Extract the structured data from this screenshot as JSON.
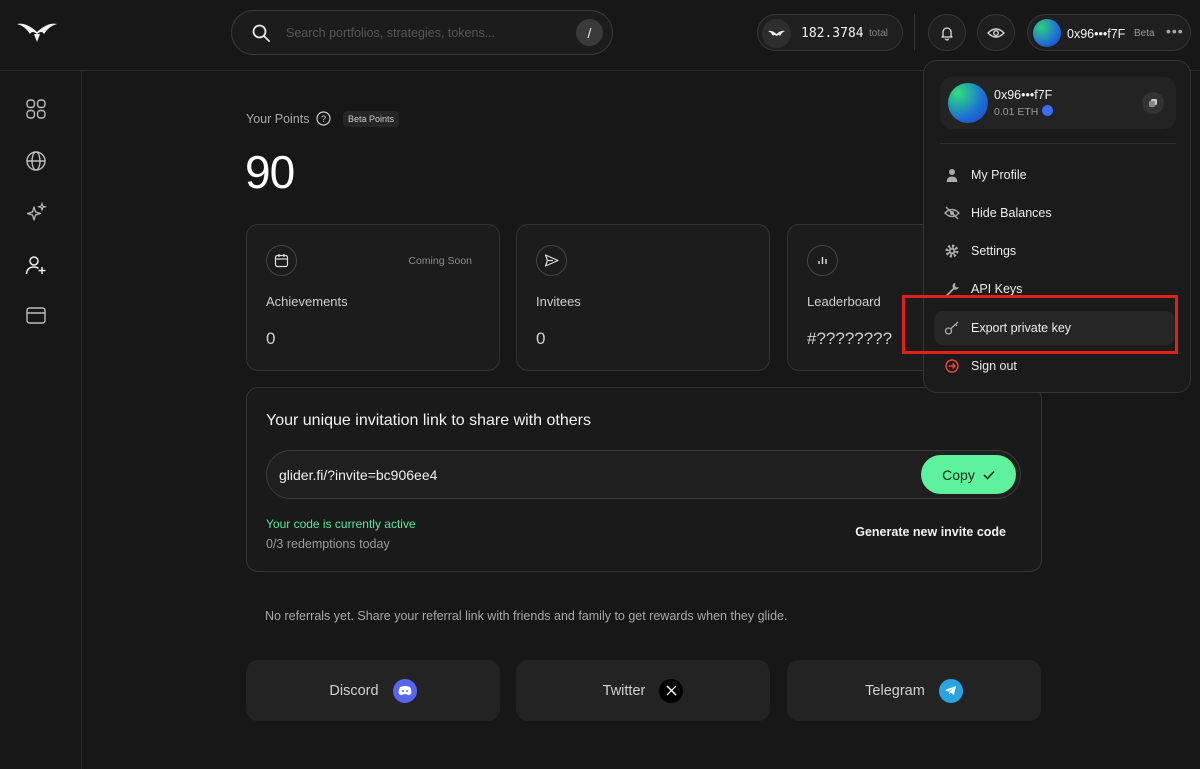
{
  "search": {
    "placeholder": "Search portfolios, strategies, tokens...",
    "shortcut": "/"
  },
  "balance": {
    "value": "182.3784",
    "suffix": "total"
  },
  "account": {
    "address": "0x96•••f7F",
    "badge": "Beta",
    "more": "•••"
  },
  "sidebar": {
    "items": [
      {
        "icon": "grid-icon"
      },
      {
        "icon": "globe-icon"
      },
      {
        "icon": "sparkles-icon"
      },
      {
        "icon": "user-plus-icon"
      },
      {
        "icon": "wallet-icon"
      }
    ]
  },
  "points": {
    "label": "Your Points",
    "badge": "Beta Points",
    "value": "90"
  },
  "cards": [
    {
      "title": "Achievements",
      "value": "0",
      "tag": "Coming Soon",
      "icon": "calendar-icon"
    },
    {
      "title": "Invitees",
      "value": "0",
      "icon": "send-icon"
    },
    {
      "title": "Leaderboard",
      "value": "#????????",
      "icon": "bar-chart-icon"
    }
  ],
  "invite": {
    "title": "Your unique invitation link to share with others",
    "link": "glider.fi/?invite=bc906ee4",
    "copy_label": "Copy",
    "status": "Your code is currently active",
    "redemptions": "0/3 redemptions today",
    "generate_label": "Generate new invite code"
  },
  "referrals": {
    "empty": "No referrals yet. Share your referral link with friends and family to get rewards when they glide."
  },
  "social": [
    {
      "label": "Discord",
      "color": "#5865f2"
    },
    {
      "label": "Twitter",
      "color": "#000000"
    },
    {
      "label": "Telegram",
      "color": "#2aa3e0"
    }
  ],
  "dropdown": {
    "address": "0x96•••f7F",
    "eth": "0.01 ETH",
    "items": [
      {
        "label": "My Profile",
        "icon": "user-icon"
      },
      {
        "label": "Hide Balances",
        "icon": "eye-off-icon"
      },
      {
        "label": "Settings",
        "icon": "gear-icon"
      },
      {
        "label": "API Keys",
        "icon": "wrench-icon"
      },
      {
        "label": "Export private key",
        "icon": "key-icon"
      },
      {
        "label": "Sign out",
        "icon": "sign-out-icon"
      }
    ]
  },
  "colors": {
    "accent": "#5ef29c",
    "highlight": "#e0221b",
    "background": "#171717"
  }
}
